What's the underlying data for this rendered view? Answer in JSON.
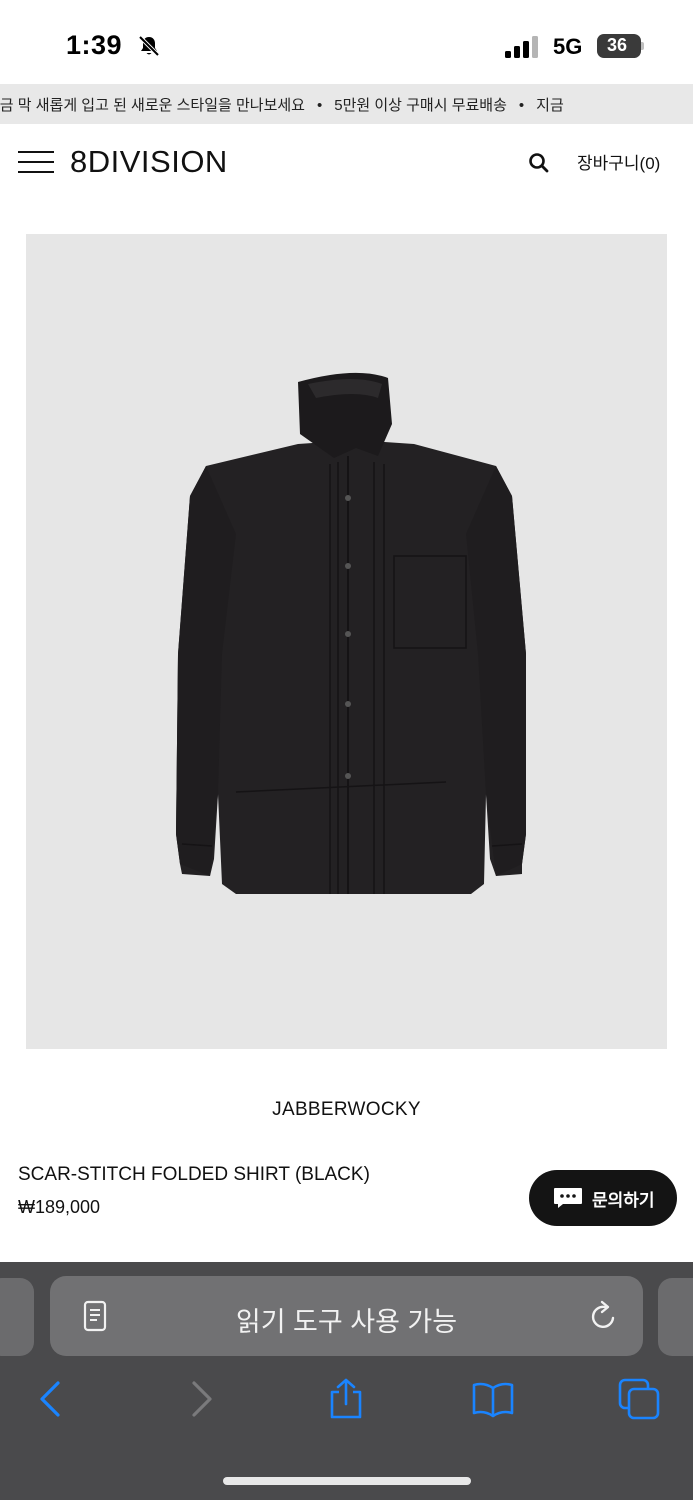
{
  "status_bar": {
    "time": "1:39",
    "network": "5G",
    "battery": "36",
    "icons": [
      "bell-slash-icon",
      "signal-bars-icon",
      "battery-icon"
    ]
  },
  "marquee": {
    "items": [
      "지금 막 새롭게 입고 된 새로운 스타일을 만나보세요",
      "5만원 이상 구매시 무료배송",
      "지금"
    ],
    "separator": "•"
  },
  "header": {
    "logo": "8DIVISION",
    "cart_label": "장바구니(0)",
    "icons": [
      "menu-icon",
      "search-icon"
    ]
  },
  "product": {
    "image_icon": "shirt-image",
    "brand": "JABBERWOCKY",
    "name": "SCAR-STITCH FOLDED SHIRT (BLACK)",
    "price": "₩189,000"
  },
  "inquiry_button": {
    "label": "문의하기",
    "icon": "chat-bubble-icon"
  },
  "browser": {
    "address_text": "읽기 도구 사용 가능",
    "icons": [
      "reader-icon",
      "reload-icon",
      "back-icon",
      "forward-icon",
      "share-icon",
      "bookmarks-icon",
      "tabs-icon"
    ]
  },
  "colors": {
    "marquee_bg": "#e8e8e8",
    "image_bg": "#e6e6e6",
    "shirt": "#232123",
    "button_bg": "#141414",
    "browser_bg": "#4a4a4c",
    "address_bg": "#717173",
    "ios_blue": "#1a84ff"
  }
}
